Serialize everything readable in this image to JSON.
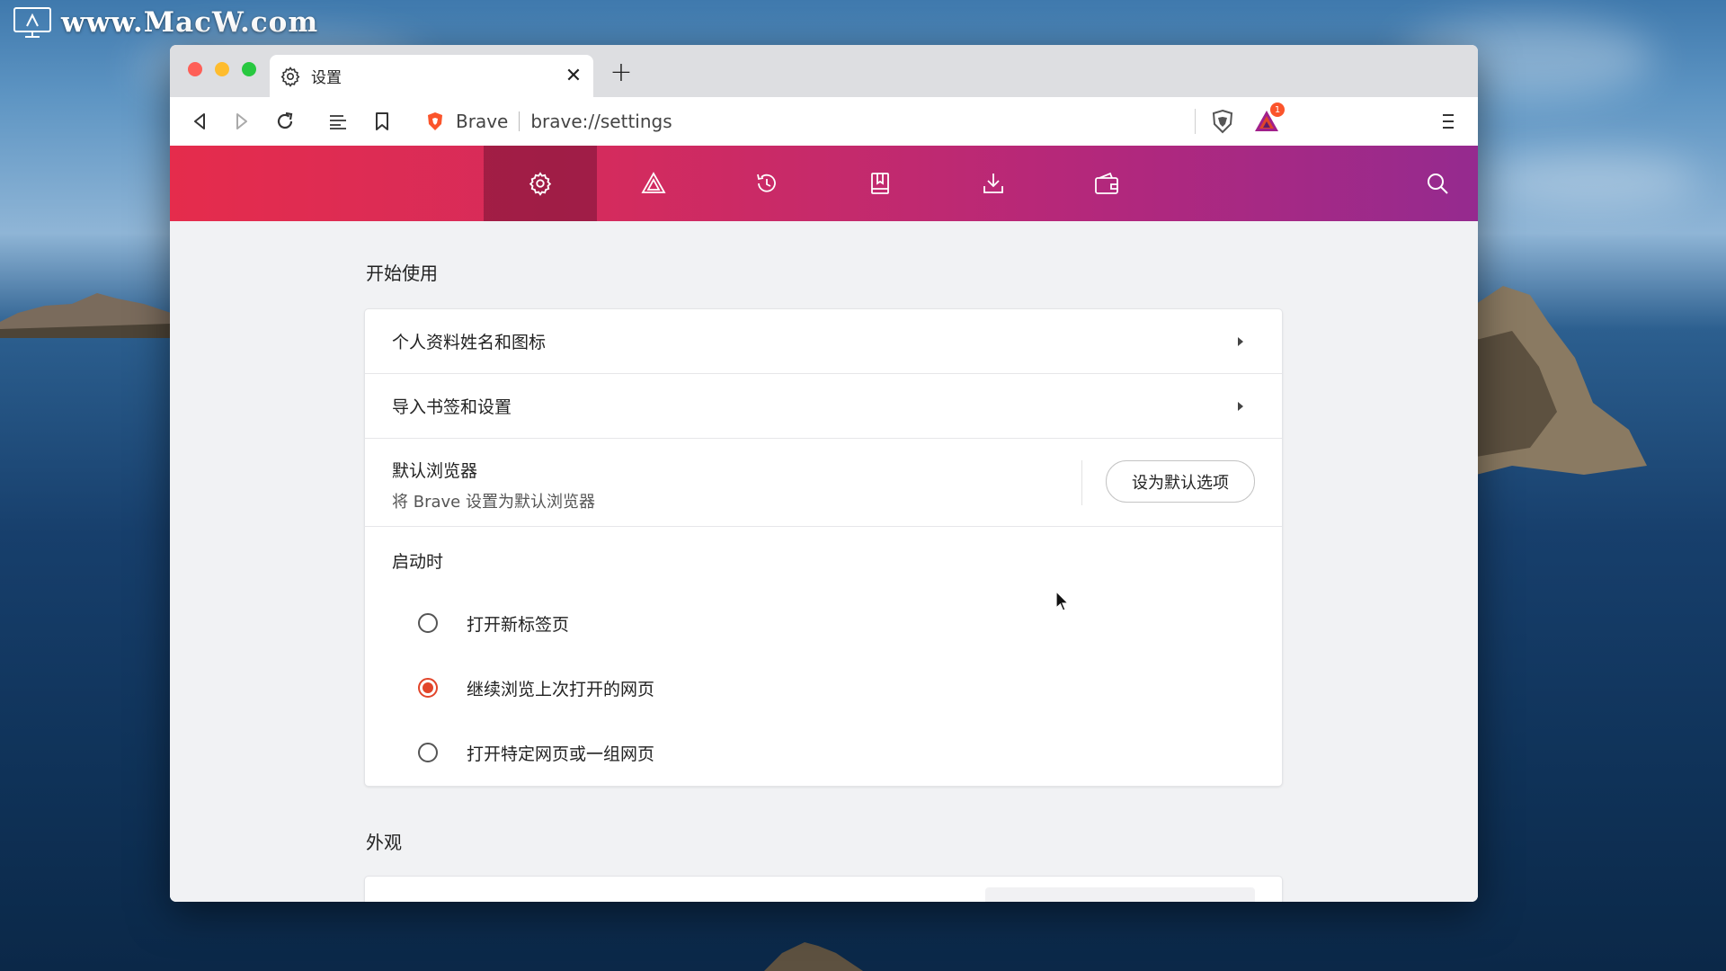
{
  "watermark": {
    "text": "www.MacW.com"
  },
  "window": {
    "tab": {
      "title": "设置",
      "icon": "gear-icon"
    },
    "toolbar": {
      "brand": "Brave",
      "url": "brave://settings",
      "rewards_badge": "1"
    }
  },
  "nav_icons": [
    "gear-icon",
    "rewards-triangle-icon",
    "history-icon",
    "bookmarks-icon",
    "download-icon",
    "wallet-icon",
    "search-icon"
  ],
  "settings": {
    "get_started": {
      "title": "开始使用",
      "profile_row": "个人资料姓名和图标",
      "import_row": "导入书签和设置",
      "default_browser": {
        "title": "默认浏览器",
        "subtitle": "将 Brave 设置为默认浏览器",
        "button": "设为默认选项"
      },
      "on_startup": {
        "title": "启动时",
        "options": [
          {
            "label": "打开新标签页",
            "selected": false
          },
          {
            "label": "继续浏览上次打开的网页",
            "selected": true
          },
          {
            "label": "打开特定网页或一组网页",
            "selected": false
          }
        ]
      }
    },
    "appearance": {
      "title": "外观"
    }
  },
  "colors": {
    "nav_gradient_start": "#e52c4c",
    "nav_gradient_end": "#952a8f",
    "radio_accent": "#e2452a"
  }
}
